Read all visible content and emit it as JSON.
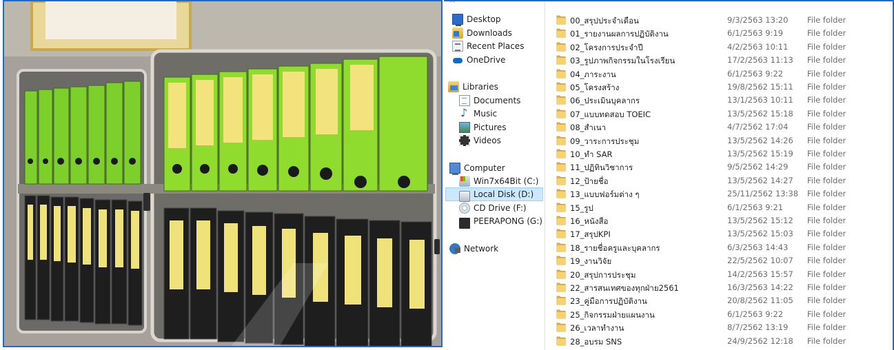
{
  "colors": {
    "selection_bg": "#cce8ff",
    "selection_border": "#99d1ff",
    "folder_yellow": "#f0c55b",
    "frame_blue": "#1c6ccf"
  },
  "nav": {
    "items": [
      {
        "label": "Desktop",
        "icon": "desktop-icon"
      },
      {
        "label": "Downloads",
        "icon": "downloads-icon"
      },
      {
        "label": "Recent Places",
        "icon": "recent-places-icon"
      },
      {
        "label": "OneDrive",
        "icon": "onedrive-icon"
      },
      {
        "label": "Libraries",
        "icon": "libraries-icon"
      },
      {
        "label": "Documents",
        "icon": "documents-icon"
      },
      {
        "label": "Music",
        "icon": "music-icon"
      },
      {
        "label": "Pictures",
        "icon": "pictures-icon"
      },
      {
        "label": "Videos",
        "icon": "videos-icon"
      },
      {
        "label": "Computer",
        "icon": "computer-icon"
      },
      {
        "label": "Win7x64Bit (C:)",
        "icon": "windows-drive-icon"
      },
      {
        "label": "Local Disk (D:)",
        "icon": "hard-drive-icon",
        "selected": true
      },
      {
        "label": "CD Drive (F:)",
        "icon": "cd-drive-icon"
      },
      {
        "label": "PEERAPONG (G:)",
        "icon": "usb-drive-icon"
      },
      {
        "label": "Network",
        "icon": "network-icon"
      }
    ]
  },
  "files": [
    {
      "name": "00_สรุปประจำเดือน",
      "date": "9/3/2563 13:20",
      "type": "File folder"
    },
    {
      "name": "01_รายงานผลการปฏิบัติงาน",
      "date": "6/1/2563 9:19",
      "type": "File folder"
    },
    {
      "name": "02_โครงการประจำปี",
      "date": "4/2/2563 10:11",
      "type": "File folder"
    },
    {
      "name": "03_รูปภาพกิจกรรมในโรงเรียน",
      "date": "17/2/2563 11:13",
      "type": "File folder"
    },
    {
      "name": "04_ภาระงาน",
      "date": "6/1/2563 9:22",
      "type": "File folder"
    },
    {
      "name": "05_โครงสร้าง",
      "date": "19/8/2562 15:11",
      "type": "File folder"
    },
    {
      "name": "06_ประเมินบุคลากร",
      "date": "13/1/2563 10:11",
      "type": "File folder"
    },
    {
      "name": "07_แบบทดสอบ TOEIC",
      "date": "13/5/2562 15:18",
      "type": "File folder"
    },
    {
      "name": "08_สำเนา",
      "date": "4/7/2562 17:04",
      "type": "File folder"
    },
    {
      "name": "09_วาระการประชุม",
      "date": "13/5/2562 14:26",
      "type": "File folder"
    },
    {
      "name": "10_ทำ SAR",
      "date": "13/5/2562 15:19",
      "type": "File folder"
    },
    {
      "name": "11_ปฏิทินวิชาการ",
      "date": "9/5/2562 14:29",
      "type": "File folder"
    },
    {
      "name": "12_ป้ายชื่อ",
      "date": "13/5/2562 14:27",
      "type": "File folder"
    },
    {
      "name": "13_แบบฟอร์มต่าง ๆ",
      "date": "25/11/2562 13:38",
      "type": "File folder"
    },
    {
      "name": "15_รูป",
      "date": "6/1/2563 9:21",
      "type": "File folder"
    },
    {
      "name": "16_หนังสือ",
      "date": "13/5/2562 15:12",
      "type": "File folder"
    },
    {
      "name": "17_สรุปKPI",
      "date": "13/5/2562 15:03",
      "type": "File folder"
    },
    {
      "name": "18_รายชื่อครูและบุคลากร",
      "date": "6/3/2563 14:43",
      "type": "File folder"
    },
    {
      "name": "19_งานวิจัย",
      "date": "22/5/2562 10:07",
      "type": "File folder"
    },
    {
      "name": "20_สรุปการประชุม",
      "date": "14/2/2563 15:57",
      "type": "File folder"
    },
    {
      "name": "22_สารสนเทศของทุกฝ่าย2561",
      "date": "16/3/2563 14:22",
      "type": "File folder"
    },
    {
      "name": "23_คู่มือการปฏิบัติงาน",
      "date": "20/8/2562 11:05",
      "type": "File folder"
    },
    {
      "name": "25_กิจกรรมฝ่ายแผนงาน",
      "date": "6/1/2563 9:22",
      "type": "File folder"
    },
    {
      "name": "26_เวลาทำงาน",
      "date": "8/7/2562 13:19",
      "type": "File folder"
    },
    {
      "name": "28_อบรม SNS",
      "date": "24/9/2562 12:18",
      "type": "File folder"
    }
  ]
}
